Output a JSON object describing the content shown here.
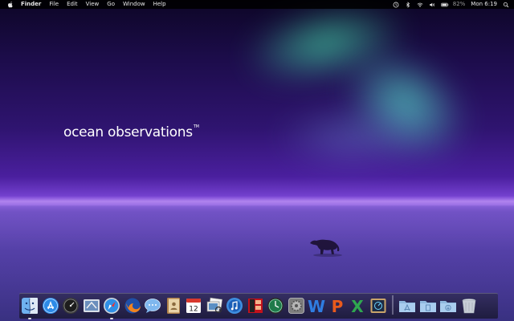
{
  "menubar": {
    "apple_icon": "apple-logo-icon",
    "app_name": "Finder",
    "menus": [
      "File",
      "Edit",
      "View",
      "Go",
      "Window",
      "Help"
    ],
    "status_icons": [
      "time-machine-icon",
      "bluetooth-icon",
      "wifi-icon",
      "volume-icon",
      "battery-icon"
    ],
    "battery_text": "82%",
    "clock": "Mon 6:19",
    "spotlight_icon": "spotlight-search-icon"
  },
  "desktop": {
    "wallpaper_text": "ocean observations",
    "wallpaper_tm": "TM"
  },
  "dock": {
    "apps": [
      {
        "icon": "finder-icon",
        "running": true
      },
      {
        "icon": "app-store-icon",
        "running": false
      },
      {
        "icon": "dashboard-icon",
        "running": false
      },
      {
        "icon": "mail-icon",
        "running": false
      },
      {
        "icon": "safari-icon",
        "running": true
      },
      {
        "icon": "firefox-icon",
        "running": false
      },
      {
        "icon": "ichat-icon",
        "running": false
      },
      {
        "icon": "address-book-icon",
        "running": false
      },
      {
        "icon": "ical-icon",
        "running": false,
        "date": "12"
      },
      {
        "icon": "preview-icon",
        "running": false
      },
      {
        "icon": "itunes-icon",
        "running": false
      },
      {
        "icon": "photo-booth-icon",
        "running": false
      },
      {
        "icon": "time-machine-icon",
        "running": false
      },
      {
        "icon": "system-preferences-icon",
        "running": false
      },
      {
        "icon": "word-icon",
        "running": false,
        "letter": "W"
      },
      {
        "icon": "powerpoint-icon",
        "running": false,
        "letter": "P"
      },
      {
        "icon": "excel-icon",
        "running": false,
        "letter": "X"
      },
      {
        "icon": "activity-monitor-icon",
        "running": false
      }
    ],
    "stacks": [
      {
        "icon": "applications-folder-icon"
      },
      {
        "icon": "documents-folder-icon"
      },
      {
        "icon": "downloads-folder-icon"
      },
      {
        "icon": "trash-icon"
      }
    ]
  },
  "colors": {
    "menubar_bg": "#000000",
    "sky_top": "#0d0626",
    "sky_mid": "#4a1f9e",
    "aurora": "#46dcaa"
  }
}
